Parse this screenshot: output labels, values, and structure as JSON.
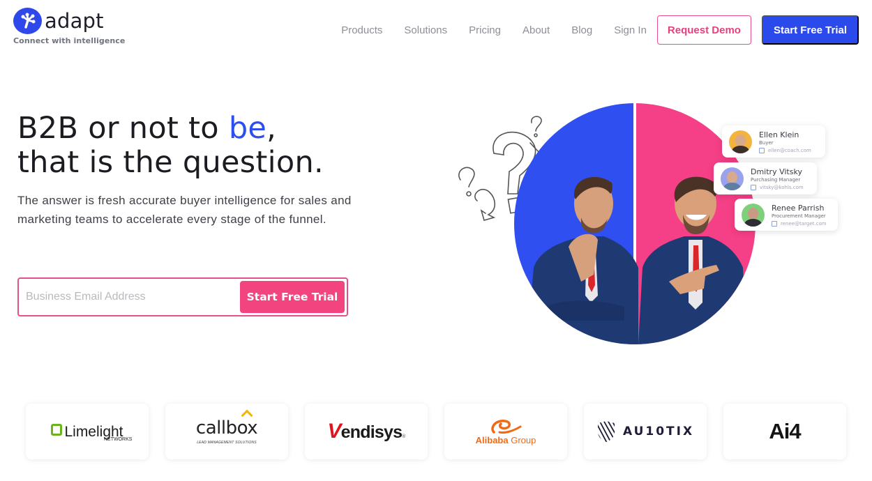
{
  "brand": {
    "name": "adapt",
    "tagline": "Connect with intelligence",
    "primary_color": "#2b4aeb",
    "accent_color": "#f2447e"
  },
  "nav": {
    "links": [
      "Products",
      "Solutions",
      "Pricing",
      "About",
      "Blog",
      "Sign In"
    ],
    "request_demo_label": "Request Demo",
    "start_trial_label": "Start Free Trial"
  },
  "hero": {
    "title_line1_prefix": "B2B or not to ",
    "title_line1_accent": "be",
    "title_line1_suffix": ",",
    "title_line2": "that is the question.",
    "subtitle": "The answer is fresh accurate buyer intelligence for sales and marketing teams to accelerate every stage of the funnel.",
    "email_placeholder": "Business Email Address",
    "email_value": "",
    "cta_label": "Start Free Trial"
  },
  "contacts": [
    {
      "name": "Ellen Klein",
      "role": "Buyer",
      "email": "ellen@coach.com",
      "avatar_color": "#f3b33d"
    },
    {
      "name": "Dmitry Vitsky",
      "role": "Purchasing Manager",
      "email": "vitsky@kohls.com",
      "avatar_color": "#9aa2ee"
    },
    {
      "name": "Renee Parrish",
      "role": "Procurement Manager",
      "email": "renee@target.com",
      "avatar_color": "#7dd17a"
    }
  ],
  "customer_logos": [
    {
      "name": "Limelight",
      "sub": "NETWORKS"
    },
    {
      "name": "callbox",
      "sub": "LEAD MANAGEMENT SOLUTIONS"
    },
    {
      "name_accent": "V",
      "name": "endisys",
      "mark": "®"
    },
    {
      "name_bold": "Alibaba",
      "name": " Group"
    },
    {
      "name": "AU10TIX"
    },
    {
      "name": "Ai4"
    }
  ]
}
